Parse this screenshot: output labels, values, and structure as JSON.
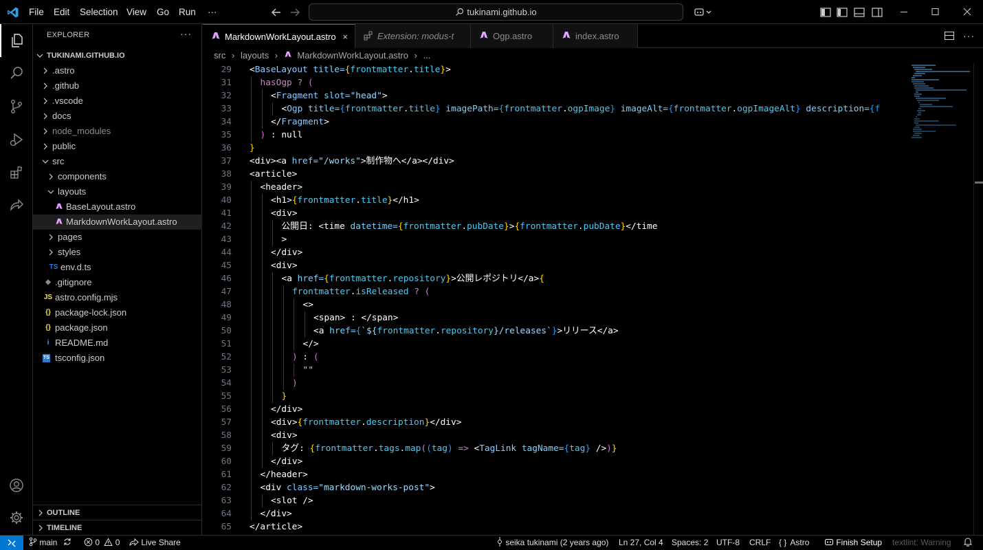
{
  "titlebar": {
    "menu": [
      "File",
      "Edit",
      "Selection",
      "View",
      "Go",
      "Run"
    ],
    "more": "···",
    "search": "tukinami.github.io",
    "icons": [
      "vscode-logo-icon",
      "back-arrow-icon",
      "forward-arrow-icon",
      "copilot-icon",
      "toggle-primary-sidebar-icon",
      "toggle-panel-icon",
      "toggle-secondary-sidebar-icon",
      "customize-layout-icon",
      "minimize-icon",
      "maximize-icon",
      "close-icon"
    ]
  },
  "activitybar": {
    "items": [
      "explorer-icon",
      "search-icon",
      "source-control-icon",
      "run-debug-icon",
      "extensions-icon",
      "live-share-icon",
      "accounts-icon",
      "manage-gear-icon"
    ]
  },
  "sidebar": {
    "title": "EXPLORER",
    "more": "···",
    "root": "TUKINAMI.GITHUB.IO",
    "items": [
      {
        "label": ".astro",
        "kind": "folder",
        "open": false,
        "dim": false
      },
      {
        "label": ".github",
        "kind": "folder",
        "open": false,
        "dim": false
      },
      {
        "label": ".vscode",
        "kind": "folder",
        "open": false,
        "dim": false
      },
      {
        "label": "docs",
        "kind": "folder",
        "open": false,
        "dim": false
      },
      {
        "label": "node_modules",
        "kind": "folder",
        "open": false,
        "dim": true
      },
      {
        "label": "public",
        "kind": "folder",
        "open": false,
        "dim": false
      },
      {
        "label": "src",
        "kind": "folder",
        "open": true,
        "dim": false
      },
      {
        "label": "components",
        "kind": "folder",
        "open": false,
        "dim": false
      },
      {
        "label": "layouts",
        "kind": "folder",
        "open": true,
        "dim": false
      },
      {
        "label": "BaseLayout.astro",
        "kind": "astro",
        "dim": false
      },
      {
        "label": "MarkdownWorkLayout.astro",
        "kind": "astro",
        "dim": false,
        "selected": true
      },
      {
        "label": "pages",
        "kind": "folder",
        "open": false,
        "dim": false
      },
      {
        "label": "styles",
        "kind": "folder",
        "open": false,
        "dim": false
      },
      {
        "label": "env.d.ts",
        "kind": "ts",
        "dim": false
      },
      {
        "label": ".gitignore",
        "kind": "git",
        "dim": false
      },
      {
        "label": "astro.config.mjs",
        "kind": "js",
        "dim": false
      },
      {
        "label": "package-lock.json",
        "kind": "json",
        "dim": false
      },
      {
        "label": "package.json",
        "kind": "json",
        "dim": false
      },
      {
        "label": "README.md",
        "kind": "info",
        "dim": false
      },
      {
        "label": "tsconfig.json",
        "kind": "tsconfig",
        "dim": false
      }
    ],
    "file_icon_glyphs": {
      "ts": "TS",
      "js": "JS",
      "json": "{}",
      "info": "i",
      "git": "◆",
      "tsconfig": "TS"
    },
    "outline": "OUTLINE",
    "timeline": "TIMELINE"
  },
  "tabs": [
    {
      "label": "MarkdownWorkLayout.astro",
      "active": true,
      "close": "×"
    },
    {
      "label": "Extension: modus-t",
      "active": false
    },
    {
      "label": "Ogp.astro",
      "active": false
    },
    {
      "label": "index.astro",
      "active": false
    }
  ],
  "breadcrumb": {
    "parts": [
      "src",
      "layouts",
      "MarkdownWorkLayout.astro",
      "..."
    ],
    "sep": "›"
  },
  "editor": {
    "lines": [
      {
        "n": "29",
        "i": 0,
        "t": [
          [
            "<",
            "t-wht"
          ],
          [
            "BaseLayout",
            "t-tag"
          ],
          [
            " title=",
            "t-attr"
          ],
          [
            "{",
            "t-brk"
          ],
          [
            "frontmatter",
            "t-var"
          ],
          [
            ".",
            "t-wht"
          ],
          [
            "title",
            "t-var"
          ],
          [
            "}",
            "t-brk"
          ],
          [
            ">",
            "t-wht"
          ]
        ]
      },
      {
        "n": "31",
        "i": 1,
        "t": [
          [
            "hasOgp ",
            "t-jsx"
          ],
          [
            "?",
            "t-jsx"
          ],
          [
            " (",
            "t-pnk"
          ]
        ]
      },
      {
        "n": "32",
        "i": 2,
        "t": [
          [
            "<",
            "t-wht"
          ],
          [
            "Fragment",
            "t-tag"
          ],
          [
            " slot=",
            "t-attr"
          ],
          [
            "\"head\"",
            "t-str"
          ],
          [
            ">",
            "t-wht"
          ]
        ]
      },
      {
        "n": "33",
        "i": 3,
        "t": [
          [
            "<",
            "t-wht"
          ],
          [
            "Ogp",
            "t-tag"
          ],
          [
            " title=",
            "t-attr"
          ],
          [
            "{",
            "t-br3"
          ],
          [
            "frontmatter",
            "t-var"
          ],
          [
            ".",
            "t-wht"
          ],
          [
            "title",
            "t-var"
          ],
          [
            "}",
            "t-br3"
          ],
          [
            " imagePath=",
            "t-attr"
          ],
          [
            "{",
            "t-br3"
          ],
          [
            "frontmatter",
            "t-var"
          ],
          [
            ".",
            "t-wht"
          ],
          [
            "ogpImage",
            "t-var"
          ],
          [
            "}",
            "t-br3"
          ],
          [
            " imageAlt=",
            "t-attr"
          ],
          [
            "{",
            "t-br3"
          ],
          [
            "frontmatter",
            "t-var"
          ],
          [
            ".",
            "t-wht"
          ],
          [
            "ogpImageAlt",
            "t-var"
          ],
          [
            "}",
            "t-br3"
          ],
          [
            " description=",
            "t-attr"
          ],
          [
            "{f",
            "t-br3"
          ]
        ]
      },
      {
        "n": "34",
        "i": 2,
        "t": [
          [
            "</",
            "t-wht"
          ],
          [
            "Fragment",
            "t-tag"
          ],
          [
            ">",
            "t-wht"
          ]
        ]
      },
      {
        "n": "35",
        "i": 1,
        "t": [
          [
            ")",
            "t-pnk"
          ],
          [
            " : ",
            "t-wht"
          ],
          [
            "null",
            "t-wht"
          ]
        ]
      },
      {
        "n": "36",
        "i": 0,
        "t": [
          [
            "}",
            "t-brk"
          ]
        ]
      },
      {
        "n": "37",
        "i": 0,
        "t": [
          [
            "<div><a",
            "t-wht"
          ],
          [
            " href=",
            "t-attr"
          ],
          [
            "\"/works\"",
            "t-str"
          ],
          [
            ">制作物へ</a></div>",
            "t-wht"
          ]
        ]
      },
      {
        "n": "38",
        "i": 0,
        "t": [
          [
            "<article>",
            "t-wht"
          ]
        ]
      },
      {
        "n": "39",
        "i": 1,
        "t": [
          [
            "<header>",
            "t-wht"
          ]
        ]
      },
      {
        "n": "40",
        "i": 2,
        "t": [
          [
            "<h1>",
            "t-wht"
          ],
          [
            "{",
            "t-brk"
          ],
          [
            "frontmatter",
            "t-var"
          ],
          [
            ".",
            "t-wht"
          ],
          [
            "title",
            "t-var"
          ],
          [
            "}",
            "t-brk"
          ],
          [
            "</h1>",
            "t-wht"
          ]
        ]
      },
      {
        "n": "41",
        "i": 2,
        "t": [
          [
            "<div>",
            "t-wht"
          ]
        ]
      },
      {
        "n": "42",
        "i": 3,
        "t": [
          [
            "公開日: ",
            "t-wht"
          ],
          [
            "<time",
            "t-wht"
          ],
          [
            " datetime=",
            "t-attr"
          ],
          [
            "{",
            "t-brk"
          ],
          [
            "frontmatter",
            "t-var"
          ],
          [
            ".",
            "t-wht"
          ],
          [
            "pubDate",
            "t-var"
          ],
          [
            "}",
            "t-brk"
          ],
          [
            ">",
            "t-wht"
          ],
          [
            "{",
            "t-brk"
          ],
          [
            "frontmatter",
            "t-var"
          ],
          [
            ".",
            "t-wht"
          ],
          [
            "pubDate",
            "t-var"
          ],
          [
            "}",
            "t-brk"
          ],
          [
            "</time",
            "t-wht"
          ]
        ]
      },
      {
        "n": "43",
        "i": 3,
        "t": [
          [
            ">",
            "t-wht"
          ]
        ]
      },
      {
        "n": "44",
        "i": 2,
        "t": [
          [
            "</div>",
            "t-wht"
          ]
        ]
      },
      {
        "n": "45",
        "i": 2,
        "t": [
          [
            "<div>",
            "t-wht"
          ]
        ]
      },
      {
        "n": "46",
        "i": 3,
        "t": [
          [
            "<a",
            "t-wht"
          ],
          [
            " href=",
            "t-attr"
          ],
          [
            "{",
            "t-brk"
          ],
          [
            "frontmatter",
            "t-var"
          ],
          [
            ".",
            "t-wht"
          ],
          [
            "repository",
            "t-var"
          ],
          [
            "}",
            "t-brk"
          ],
          [
            ">公開レポジトリ</a>",
            "t-wht"
          ],
          [
            "{",
            "t-brk"
          ]
        ]
      },
      {
        "n": "47",
        "i": 4,
        "t": [
          [
            "frontmatter",
            "t-var"
          ],
          [
            ".",
            "t-wht"
          ],
          [
            "isReleased",
            "t-var"
          ],
          [
            " ? ",
            "t-jsx"
          ],
          [
            "(",
            "t-pnk"
          ]
        ]
      },
      {
        "n": "48",
        "i": 5,
        "t": [
          [
            "<>",
            "t-wht"
          ]
        ]
      },
      {
        "n": "49",
        "i": 6,
        "t": [
          [
            "<span>",
            "t-wht"
          ],
          [
            " : ",
            "t-wht"
          ],
          [
            "</span>",
            "t-wht"
          ]
        ]
      },
      {
        "n": "50",
        "i": 6,
        "t": [
          [
            "<a",
            "t-wht"
          ],
          [
            " href=",
            "t-attr"
          ],
          [
            "{",
            "t-br3"
          ],
          [
            "`${",
            "t-str"
          ],
          [
            "frontmatter",
            "t-var"
          ],
          [
            ".",
            "t-wht"
          ],
          [
            "repository",
            "t-var"
          ],
          [
            "}/releases`",
            "t-str"
          ],
          [
            "}",
            "t-br3"
          ],
          [
            ">リリース</a>",
            "t-wht"
          ]
        ]
      },
      {
        "n": "51",
        "i": 5,
        "t": [
          [
            "</>",
            "t-wht"
          ]
        ]
      },
      {
        "n": "52",
        "i": 4,
        "t": [
          [
            ")",
            "t-pnk"
          ],
          [
            " : ",
            "t-wht"
          ],
          [
            "(",
            "t-pnk"
          ]
        ]
      },
      {
        "n": "53",
        "i": 5,
        "t": [
          [
            "\"\"",
            "t-str"
          ]
        ]
      },
      {
        "n": "54",
        "i": 4,
        "t": [
          [
            ")",
            "t-pnk"
          ]
        ]
      },
      {
        "n": "55",
        "i": 3,
        "t": [
          [
            "}",
            "t-brk"
          ]
        ]
      },
      {
        "n": "56",
        "i": 2,
        "t": [
          [
            "</div>",
            "t-wht"
          ]
        ]
      },
      {
        "n": "57",
        "i": 2,
        "t": [
          [
            "<div>",
            "t-wht"
          ],
          [
            "{",
            "t-brk"
          ],
          [
            "frontmatter",
            "t-var"
          ],
          [
            ".",
            "t-wht"
          ],
          [
            "description",
            "t-var"
          ],
          [
            "}",
            "t-brk"
          ],
          [
            "</div>",
            "t-wht"
          ]
        ]
      },
      {
        "n": "58",
        "i": 2,
        "t": [
          [
            "<div>",
            "t-wht"
          ]
        ]
      },
      {
        "n": "59",
        "i": 3,
        "t": [
          [
            "タグ: ",
            "t-wht"
          ],
          [
            "{",
            "t-brk"
          ],
          [
            "frontmatter",
            "t-var"
          ],
          [
            ".",
            "t-wht"
          ],
          [
            "tags",
            "t-var"
          ],
          [
            ".",
            "t-wht"
          ],
          [
            "map",
            "t-var"
          ],
          [
            "(",
            "t-pnk"
          ],
          [
            "(",
            "t-br3"
          ],
          [
            "tag",
            "t-var"
          ],
          [
            ")",
            "t-br3"
          ],
          [
            " => ",
            "t-jsx"
          ],
          [
            "<",
            "t-wht"
          ],
          [
            "TagLink",
            "t-tag"
          ],
          [
            " tagName=",
            "t-attr"
          ],
          [
            "{",
            "t-br3"
          ],
          [
            "tag",
            "t-var"
          ],
          [
            "}",
            "t-br3"
          ],
          [
            " />",
            "t-wht"
          ],
          [
            ")",
            "t-pnk"
          ],
          [
            "}",
            "t-brk"
          ]
        ]
      },
      {
        "n": "60",
        "i": 2,
        "t": [
          [
            "</div>",
            "t-wht"
          ]
        ]
      },
      {
        "n": "61",
        "i": 1,
        "t": [
          [
            "</header>",
            "t-wht"
          ]
        ]
      },
      {
        "n": "62",
        "i": 1,
        "t": [
          [
            "<div",
            "t-wht"
          ],
          [
            " class=",
            "t-attr"
          ],
          [
            "\"markdown-works-post\"",
            "t-str"
          ],
          [
            ">",
            "t-wht"
          ]
        ]
      },
      {
        "n": "63",
        "i": 2,
        "t": [
          [
            "<slot />",
            "t-wht"
          ]
        ]
      },
      {
        "n": "64",
        "i": 1,
        "t": [
          [
            "</div>",
            "t-wht"
          ]
        ]
      },
      {
        "n": "65",
        "i": 0,
        "t": [
          [
            "</article>",
            "t-wht"
          ]
        ]
      }
    ]
  },
  "statusbar": {
    "branch": "main",
    "errors": "0",
    "warnings": "0",
    "live_share": "Live Share",
    "blame": "seika tukinami (2 years ago)",
    "position": "Ln 27, Col 4",
    "spaces": "Spaces: 2",
    "encoding": "UTF-8",
    "eol": "CRLF",
    "language": "Astro",
    "finish_setup": "Finish Setup",
    "textlint": "textlint: Warning"
  },
  "colors": {
    "accent": "#0078d4",
    "astro": "#e2a1ff",
    "ts": "#3178c6",
    "js": "#f1e05a",
    "json": "#f1e05a"
  }
}
